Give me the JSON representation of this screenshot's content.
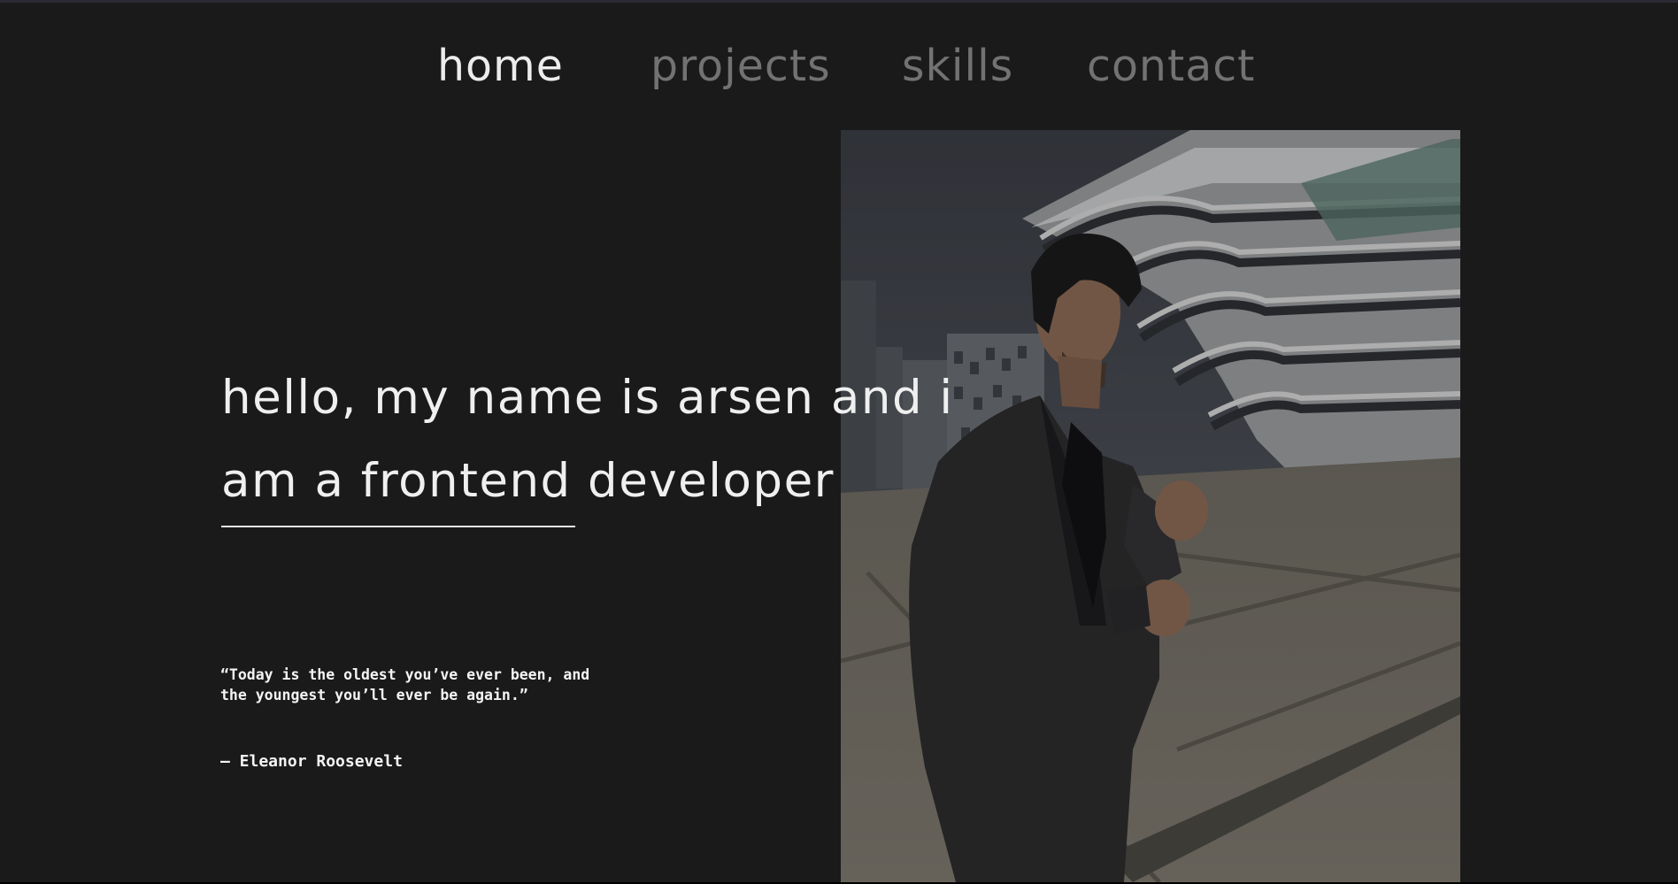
{
  "nav": {
    "items": [
      {
        "label": "home",
        "active": true
      },
      {
        "label": "projects",
        "active": false
      },
      {
        "label": "skills",
        "active": false
      },
      {
        "label": "contact",
        "active": false
      }
    ]
  },
  "hero": {
    "heading_line_1": "hello, my name is arsen and i",
    "heading_line_2": "am a frontend developer",
    "quote_line_1": "“Today is the oldest you’ve ever been, and",
    "quote_line_2": "the youngest you’ll ever be again.”",
    "author": "— Eleanor Roosevelt"
  },
  "photo": {
    "subject": "man in dark suit in front of modern curved building"
  },
  "colors": {
    "background": "#1a1a1b",
    "nav_active": "#ececec",
    "nav_inactive": "#727272",
    "text": "#efefef"
  }
}
